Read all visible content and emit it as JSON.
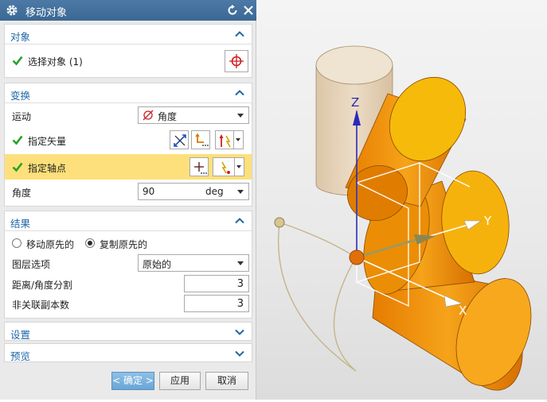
{
  "dialog": {
    "title": "移动对象"
  },
  "object_section": {
    "title": "对象",
    "select_label": "选择对象 (1)"
  },
  "transform_section": {
    "title": "变换",
    "motion_label": "运动",
    "motion_value": "角度",
    "vector_label": "指定矢量",
    "pivot_label": "指定轴点",
    "angle_label": "角度",
    "angle_value": "90",
    "angle_unit": "deg"
  },
  "result_section": {
    "title": "结果",
    "radio_move": "移动原先的",
    "radio_copy": "复制原先的",
    "layer_label": "图层选项",
    "layer_value": "原始的",
    "distance_label": "距离/角度分割",
    "distance_value": "3",
    "copies_label": "非关联副本数",
    "copies_value": "3"
  },
  "settings_section": {
    "title": "设置"
  },
  "preview_section": {
    "title": "预览"
  },
  "buttons": {
    "ok": "< 确定 >",
    "apply": "应用",
    "cancel": "取消"
  },
  "viewport": {
    "axis_z": "Z",
    "axis_y": "Y",
    "axis_x": "X"
  },
  "colors": {
    "title_bar": "#3f6d99",
    "section_title": "#1f67a8",
    "highlight_row": "#fde07b",
    "check_green": "#27a327",
    "cylinder_orange": "#f39a0a",
    "ghost_cylinder": "#e7d5bc",
    "axis_blue": "#2a2ab8"
  }
}
